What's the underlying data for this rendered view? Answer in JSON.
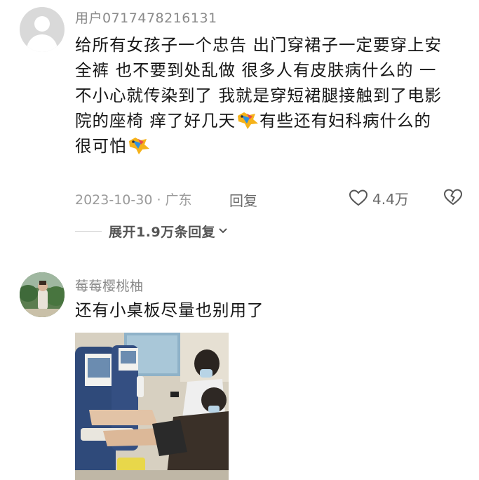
{
  "comments": [
    {
      "username": "用户0717478216131",
      "lines": [
        "给所有女孩子一个忠告 出门穿裙子一定要穿上安",
        "全裤 也不要到处乱做 很多人有皮肤病什么的 一",
        "不小心就传染到了 我就是穿短裙腿接触到了电影",
        "院的座椅 痒了好几天",
        "有些还有妇科病什么的",
        "很可怕"
      ],
      "emoji": "star-face-emoji",
      "date_location": "2023-10-30 · 广东",
      "reply_label": "回复",
      "like_count": "4.4万",
      "expand_label": "展开1.9万条回复"
    },
    {
      "username": "莓莓樱桃柚",
      "text": "还有小桌板尽量也别用了"
    }
  ],
  "icons": {
    "like": "heart-outline-icon",
    "dislike": "broken-heart-icon",
    "expand": "chevron-down-icon"
  },
  "colors": {
    "username": "#8a8a8a",
    "text": "#161616",
    "meta": "#9a9a9a"
  }
}
